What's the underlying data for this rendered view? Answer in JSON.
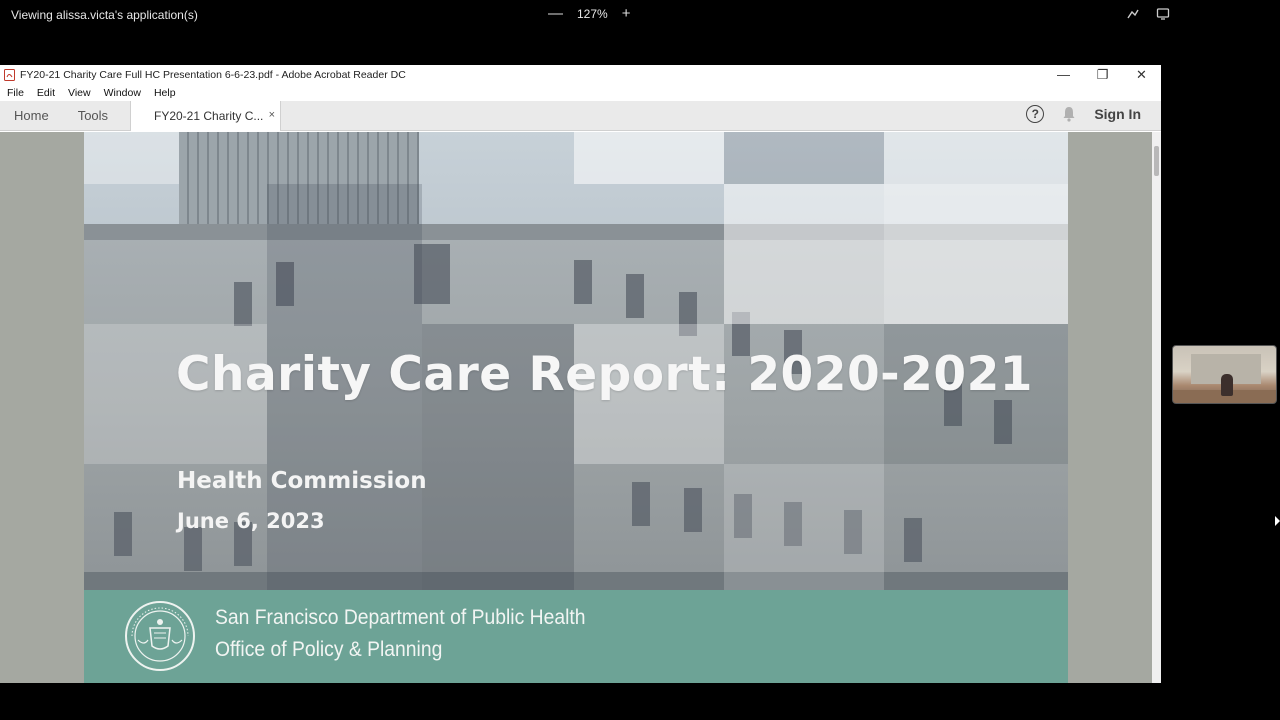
{
  "share": {
    "viewing_text": "Viewing alissa.victa's application(s)",
    "zoom_level": "127%",
    "zoom_out": "—",
    "zoom_in": "+"
  },
  "window": {
    "title": "FY20-21 Charity Care Full HC Presentation 6-6-23.pdf - Adobe Acrobat Reader DC",
    "minimize": "—",
    "restore": "❐",
    "close": "✕"
  },
  "menu": [
    "File",
    "Edit",
    "View",
    "Window",
    "Help"
  ],
  "tabs": {
    "home": "Home",
    "tools": "Tools",
    "document": "FY20-21 Charity C...",
    "document_close": "×",
    "sign_in": "Sign In",
    "help_symbol": "?"
  },
  "slide": {
    "title": "Charity Care Report: 2020-2021",
    "subtitle": "Health Commission",
    "date": "June 6, 2023",
    "department": "San Francisco Department of Public Health",
    "office": "Office of Policy & Planning"
  },
  "colors": {
    "footer_teal": "#6da396",
    "viewer_bg": "#a5a8a1"
  },
  "icons": {
    "pdf": "pdf-file-icon",
    "help": "help-circle-icon",
    "bell": "bell-icon",
    "annotate": "annotate-icon",
    "remote": "remote-control-icon"
  }
}
